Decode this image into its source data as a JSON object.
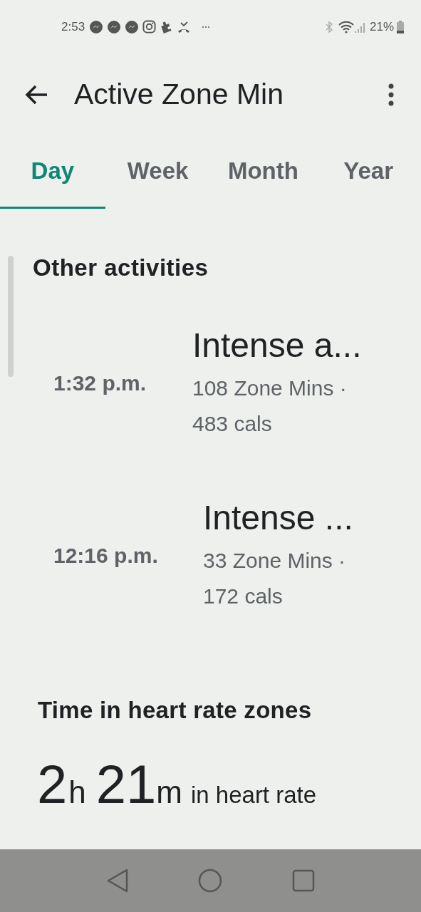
{
  "status_bar": {
    "time": "2:53",
    "battery": "21%"
  },
  "header": {
    "title": "Active Zone Min"
  },
  "tabs": [
    {
      "label": "Day",
      "selected": true
    },
    {
      "label": "Week",
      "selected": false
    },
    {
      "label": "Month",
      "selected": false
    },
    {
      "label": "Year",
      "selected": false
    }
  ],
  "other_activities": {
    "heading": "Other activities",
    "items": [
      {
        "time": "1:32 p.m.",
        "title": "Intense a...",
        "details": "108 Zone Mins ·",
        "calories": "483 cals"
      },
      {
        "time": "12:16 p.m.",
        "title": "Intense ...",
        "details": "33 Zone Mins ·",
        "calories": "172 cals"
      }
    ]
  },
  "heart_rate_zones": {
    "heading": "Time in heart rate zones",
    "hours": "2",
    "hours_unit": "h",
    "minutes": "21",
    "minutes_unit": "m",
    "caption": "in heart rate"
  }
}
